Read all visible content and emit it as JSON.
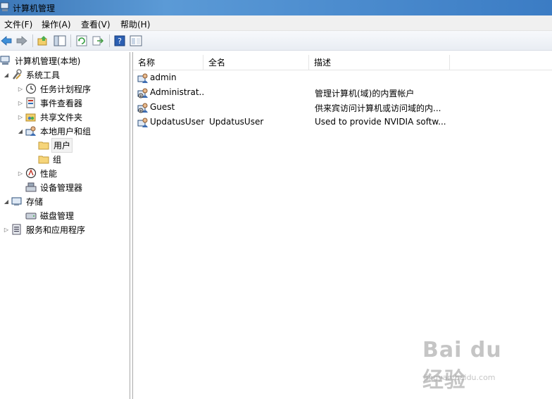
{
  "window": {
    "title": "计算机管理"
  },
  "menu": [
    "文件(F)",
    "操作(A)",
    "查看(V)",
    "帮助(H)"
  ],
  "toolbar": {
    "buttons": [
      "back-arrow-icon",
      "forward-arrow-icon",
      "up-folder-icon",
      "show-tree-icon",
      "refresh-icon",
      "export-icon",
      "help-icon",
      "properties-icon"
    ]
  },
  "tree": {
    "root": "计算机管理(本地)",
    "system_tools": "系统工具",
    "task_scheduler": "任务计划程序",
    "event_viewer": "事件查看器",
    "shared_folders": "共享文件夹",
    "local_users_groups": "本地用户和组",
    "users": "用户",
    "groups": "组",
    "performance": "性能",
    "device_manager": "设备管理器",
    "storage": "存储",
    "disk_management": "磁盘管理",
    "services_apps": "服务和应用程序"
  },
  "list": {
    "columns": [
      "名称",
      "全名",
      "描述"
    ],
    "rows": [
      {
        "name": "admin",
        "fullname": "",
        "description": ""
      },
      {
        "name": "Administrat...",
        "fullname": "",
        "description": "管理计算机(域)的内置帐户"
      },
      {
        "name": "Guest",
        "fullname": "",
        "description": "供来宾访问计算机或访问域的内..."
      },
      {
        "name": "UpdatusUser",
        "fullname": "UpdatusUser",
        "description": "Used to provide NVIDIA softw..."
      }
    ]
  },
  "watermark": {
    "logo": "Bai du 经验",
    "url": "jingyan.baidu.com"
  },
  "colors": {
    "titlebar": "#4f8fd0",
    "toolbar": "#e9edf3",
    "pane_border": "#a9a9a9"
  }
}
